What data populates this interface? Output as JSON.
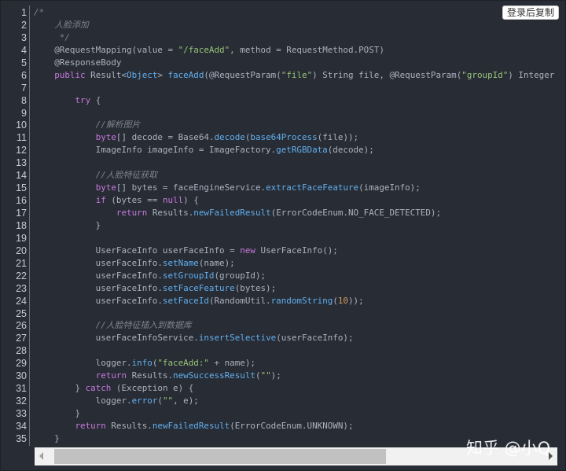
{
  "copy_button": "登录后复制",
  "watermark": "知乎 @小Q",
  "scrollbar": {
    "thumb_fraction": 0.64,
    "position_fraction": 0
  },
  "code_lines": [
    [
      [
        "c",
        "/*"
      ]
    ],
    [
      [
        "c",
        "    人脸添加"
      ]
    ],
    [
      [
        "c",
        "     */"
      ]
    ],
    [
      [
        "p",
        "    @RequestMapping(value = "
      ],
      [
        "s",
        "\"/faceAdd\""
      ],
      [
        "p",
        ", method = RequestMethod.POST)"
      ]
    ],
    [
      [
        "p",
        "    @ResponseBody"
      ]
    ],
    [
      [
        "p",
        "    "
      ],
      [
        "k",
        "public"
      ],
      [
        "p",
        " Result<"
      ],
      [
        "t",
        "Object"
      ],
      [
        "p",
        "> "
      ],
      [
        "f",
        "faceAdd"
      ],
      [
        "p",
        "(@RequestParam("
      ],
      [
        "s",
        "\"file\""
      ],
      [
        "p",
        ") String file, @RequestParam("
      ],
      [
        "s",
        "\"groupId\""
      ],
      [
        "p",
        ") Integer"
      ]
    ],
    [
      [
        "p",
        ""
      ]
    ],
    [
      [
        "p",
        "        "
      ],
      [
        "k",
        "try"
      ],
      [
        "p",
        " {"
      ]
    ],
    [
      [
        "p",
        ""
      ]
    ],
    [
      [
        "c",
        "            //解析图片"
      ]
    ],
    [
      [
        "p",
        "            "
      ],
      [
        "k",
        "byte"
      ],
      [
        "p",
        "[] decode = Base64."
      ],
      [
        "f",
        "decode"
      ],
      [
        "p",
        "("
      ],
      [
        "f",
        "base64Process"
      ],
      [
        "p",
        "(file));"
      ]
    ],
    [
      [
        "p",
        "            ImageInfo imageInfo = ImageFactory."
      ],
      [
        "f",
        "getRGBData"
      ],
      [
        "p",
        "(decode);"
      ]
    ],
    [
      [
        "p",
        ""
      ]
    ],
    [
      [
        "c",
        "            //人脸特征获取"
      ]
    ],
    [
      [
        "p",
        "            "
      ],
      [
        "k",
        "byte"
      ],
      [
        "p",
        "[] bytes = faceEngineService."
      ],
      [
        "f",
        "extractFaceFeature"
      ],
      [
        "p",
        "(imageInfo);"
      ]
    ],
    [
      [
        "p",
        "            "
      ],
      [
        "k",
        "if"
      ],
      [
        "p",
        " (bytes == "
      ],
      [
        "k",
        "null"
      ],
      [
        "p",
        ") {"
      ]
    ],
    [
      [
        "p",
        "                "
      ],
      [
        "k",
        "return"
      ],
      [
        "p",
        " Results."
      ],
      [
        "f",
        "newFailedResult"
      ],
      [
        "p",
        "(ErrorCodeEnum.NO_FACE_DETECTED);"
      ]
    ],
    [
      [
        "p",
        "            }"
      ]
    ],
    [
      [
        "p",
        ""
      ]
    ],
    [
      [
        "p",
        "            UserFaceInfo userFaceInfo = "
      ],
      [
        "k",
        "new"
      ],
      [
        "p",
        " UserFaceInfo();"
      ]
    ],
    [
      [
        "p",
        "            userFaceInfo."
      ],
      [
        "f",
        "setName"
      ],
      [
        "p",
        "(name);"
      ]
    ],
    [
      [
        "p",
        "            userFaceInfo."
      ],
      [
        "f",
        "setGroupId"
      ],
      [
        "p",
        "(groupId);"
      ]
    ],
    [
      [
        "p",
        "            userFaceInfo."
      ],
      [
        "f",
        "setFaceFeature"
      ],
      [
        "p",
        "(bytes);"
      ]
    ],
    [
      [
        "p",
        "            userFaceInfo."
      ],
      [
        "f",
        "setFaceId"
      ],
      [
        "p",
        "(RandomUtil."
      ],
      [
        "f",
        "randomString"
      ],
      [
        "p",
        "("
      ],
      [
        "n",
        "10"
      ],
      [
        "p",
        "));"
      ]
    ],
    [
      [
        "p",
        ""
      ]
    ],
    [
      [
        "c",
        "            //人脸特征插入到数据库"
      ]
    ],
    [
      [
        "p",
        "            userFaceInfoService."
      ],
      [
        "f",
        "insertSelective"
      ],
      [
        "p",
        "(userFaceInfo);"
      ]
    ],
    [
      [
        "p",
        ""
      ]
    ],
    [
      [
        "p",
        "            logger."
      ],
      [
        "f",
        "info"
      ],
      [
        "p",
        "("
      ],
      [
        "s",
        "\"faceAdd:\""
      ],
      [
        "p",
        " + name);"
      ]
    ],
    [
      [
        "p",
        "            "
      ],
      [
        "k",
        "return"
      ],
      [
        "p",
        " Results."
      ],
      [
        "f",
        "newSuccessResult"
      ],
      [
        "p",
        "("
      ],
      [
        "s",
        "\"\""
      ],
      [
        "p",
        ");"
      ]
    ],
    [
      [
        "p",
        "        } "
      ],
      [
        "k",
        "catch"
      ],
      [
        "p",
        " (Exception e) {"
      ]
    ],
    [
      [
        "p",
        "            logger."
      ],
      [
        "f",
        "error"
      ],
      [
        "p",
        "("
      ],
      [
        "s",
        "\"\""
      ],
      [
        "p",
        ", e);"
      ]
    ],
    [
      [
        "p",
        "        }"
      ]
    ],
    [
      [
        "p",
        "        "
      ],
      [
        "k",
        "return"
      ],
      [
        "p",
        " Results."
      ],
      [
        "f",
        "newFailedResult"
      ],
      [
        "p",
        "(ErrorCodeEnum.UNKNOWN);"
      ]
    ],
    [
      [
        "p",
        "    }"
      ]
    ]
  ]
}
